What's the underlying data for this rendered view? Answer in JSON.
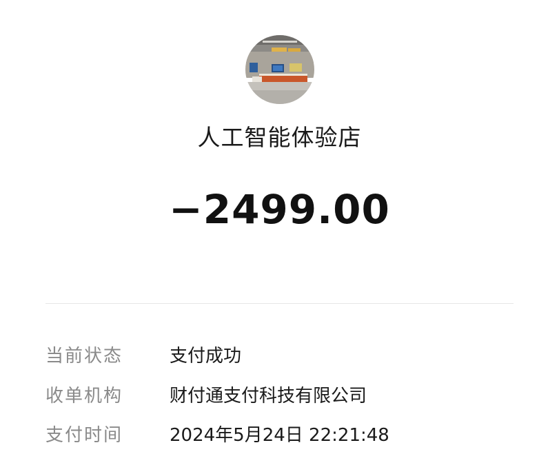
{
  "merchant": {
    "avatar_icon": "store-photo-avatar",
    "name": "人工智能体验店"
  },
  "amount": "−2499.00",
  "details": [
    {
      "label": "当前状态",
      "value": "支付成功"
    },
    {
      "label": "收单机构",
      "value": "财付通支付科技有限公司"
    },
    {
      "label": "支付时间",
      "value": "2024年5月24日 22:21:48"
    }
  ]
}
